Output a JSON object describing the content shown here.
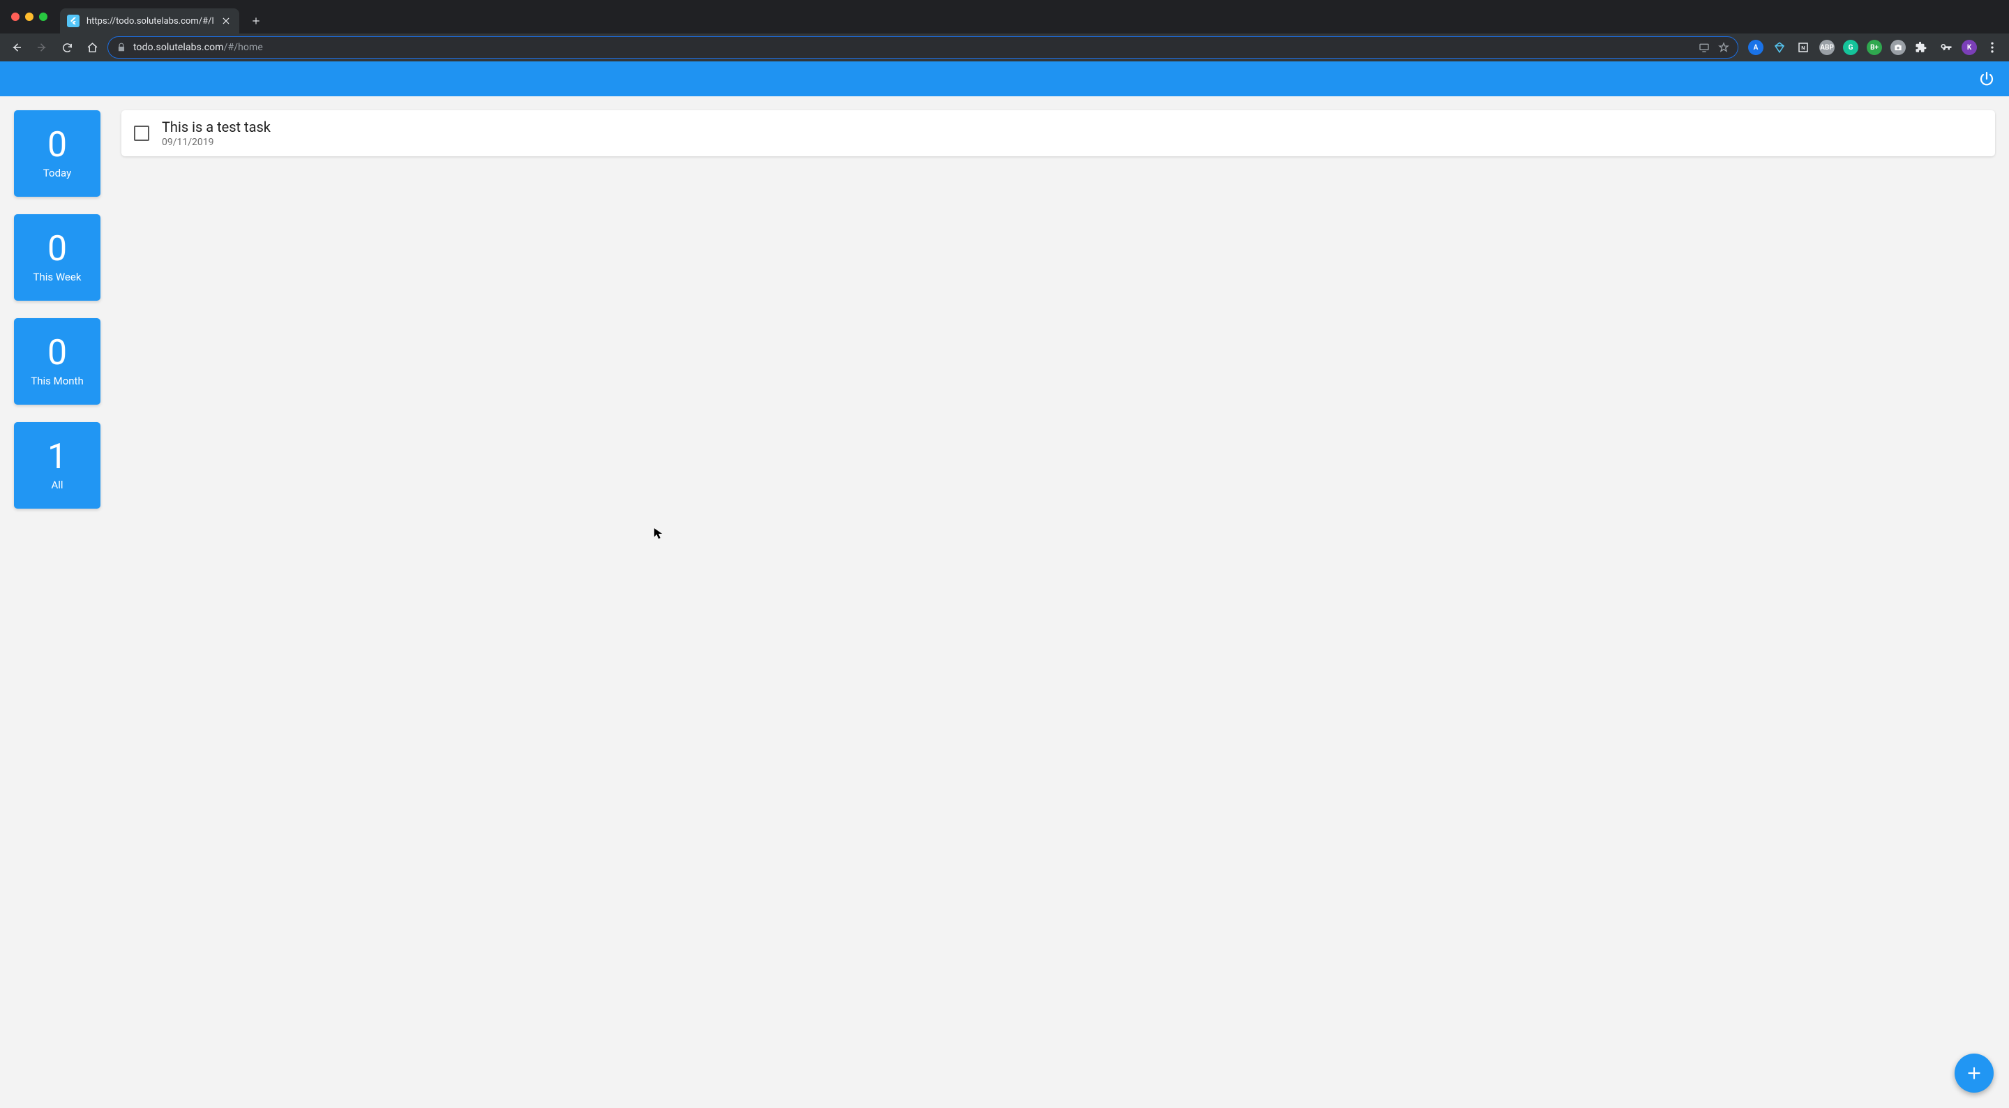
{
  "browser": {
    "tab_title": "https://todo.solutelabs.com/#/l",
    "url_domain": "todo.solutelabs.com",
    "url_path": "/#/home",
    "extensions": [
      {
        "letter": "A",
        "bg": "#1a73e8"
      },
      {
        "letter": "",
        "bg": "transparent",
        "diamond": true,
        "color": "#56c7f2"
      },
      {
        "letter": "N",
        "bg": "transparent",
        "square": true,
        "color": "#e8eaed"
      },
      {
        "letter": "ABP",
        "bg": "#9aa0a6"
      },
      {
        "letter": "G",
        "bg": "#15c39a"
      },
      {
        "letter": "B+",
        "bg": "#2fa84f"
      },
      {
        "letter": "",
        "bg": "#9aa0a6",
        "camera": true
      }
    ],
    "profile_letter": "K",
    "profile_bg": "#7b3fb8"
  },
  "app": {
    "filters": [
      {
        "count": "0",
        "label": "Today"
      },
      {
        "count": "0",
        "label": "This Week"
      },
      {
        "count": "0",
        "label": "This Month"
      },
      {
        "count": "1",
        "label": "All"
      }
    ],
    "tasks": [
      {
        "title": "This is a test task",
        "date": "09/11/2019",
        "done": false
      }
    ]
  }
}
